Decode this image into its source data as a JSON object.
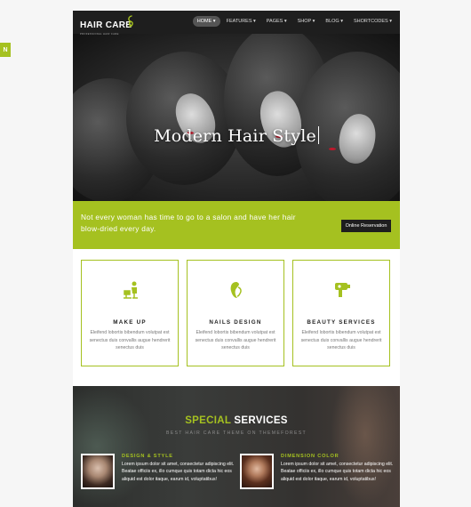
{
  "side_tab": {
    "label": "N"
  },
  "brand": {
    "name": "HAIR CARE",
    "tagline": "PROFESSIONAL HAIR CARE"
  },
  "nav": {
    "items": [
      {
        "label": "HOME ▾"
      },
      {
        "label": "FEATURES ▾"
      },
      {
        "label": "PAGES ▾"
      },
      {
        "label": "SHOP ▾"
      },
      {
        "label": "BLOG ▾"
      },
      {
        "label": "SHORTCODES ▾"
      }
    ]
  },
  "hero": {
    "title": "Modern Hair Style"
  },
  "banner": {
    "text": "Not every woman has time to go to a salon and have her hair blow-dried every day.",
    "button": "Online Reservation"
  },
  "cards": [
    {
      "title": "MAKE UP",
      "icon": "salon-chair-icon",
      "desc": "Eleifend lobortis bibendum volutpat est senectus duis convallis augue hendrerit senectus duis"
    },
    {
      "title": "NAILS DESIGN",
      "icon": "woman-head-icon",
      "desc": "Eleifend lobortis bibendum volutpat est senectus duis convallis augue hendrerit senectus duis"
    },
    {
      "title": "BEAUTY SERVICES",
      "icon": "hair-dryer-icon",
      "desc": "Eleifend lobortis bibendum volutpat est senectus duis convallis augue hendrerit senectus duis"
    }
  ],
  "special": {
    "title_highlight": "SPECIAL",
    "title_rest": " SERVICES",
    "subtitle": "BEST HAIR CARE THEME ON THEMEFOREST",
    "items": [
      {
        "name": "DESIGN & STYLE",
        "desc": "Lorem ipsum dolor sit amet, consectetur adipiscing elit. Beatae officiis ex, illo cumque quis totam dicta hic eos aliquid est dolor itaque, earum id, voluptatibus!"
      },
      {
        "name": "DIMENSION COLOR",
        "desc": "Lorem ipsum dolor sit amet, consectetur adipiscing elit. Beatae officiis ex, illo cumque quis totam dicta hic eos aliquid est dolor itaque, earum id, voluptatibus!"
      }
    ]
  },
  "colors": {
    "accent": "#a5c120",
    "dark": "#1e1e1e",
    "lips": "#c0182b"
  }
}
